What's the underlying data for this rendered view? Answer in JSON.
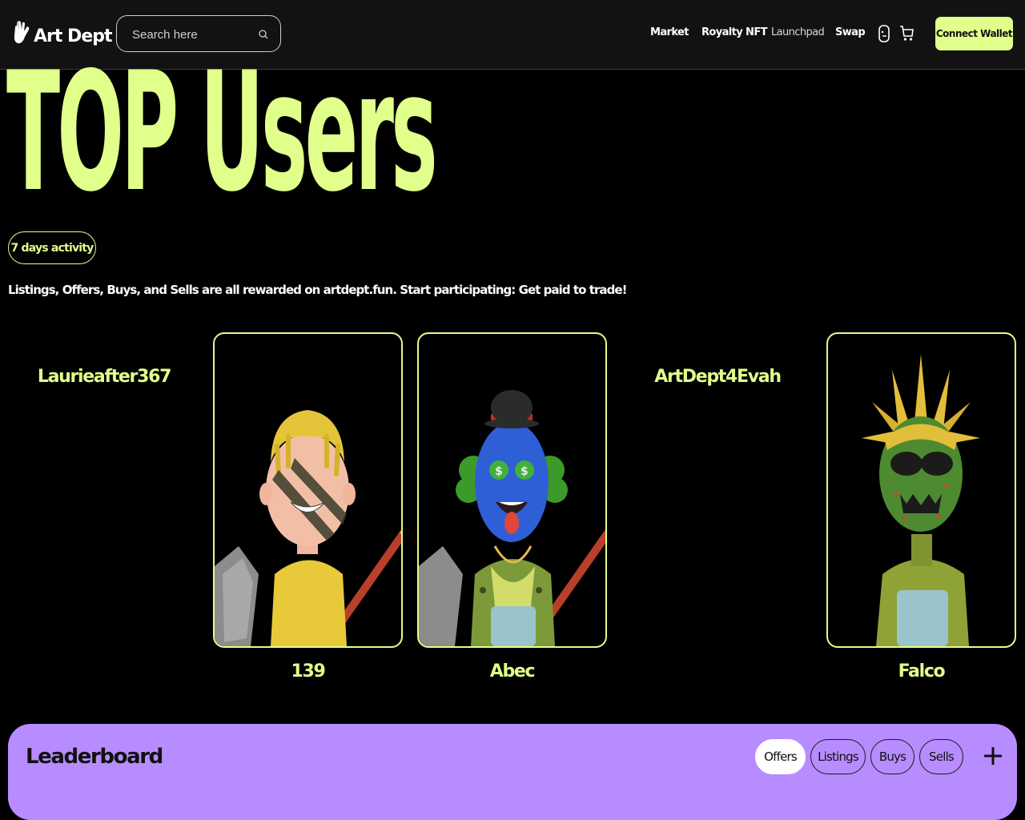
{
  "header": {
    "logo_text": "Art Dept",
    "search_placeholder": "Search here",
    "nav": [
      "Market",
      "Royalty NFT",
      "Launchpad",
      "Swap"
    ],
    "connect_label": "Connect Wallet"
  },
  "hero": {
    "title": "TOP Users",
    "activity_label": "7 days activity",
    "tagline": "Listings, Offers, Buys, and Sells are all rewarded on artdept.fun. Start participating: Get paid to trade!"
  },
  "users": [
    {
      "name": "Laurieafter367",
      "has_image": false
    },
    {
      "name": "139",
      "has_image": true
    },
    {
      "name": "Abec",
      "has_image": true
    },
    {
      "name": "ArtDept4Evah",
      "has_image": false
    },
    {
      "name": "Falco",
      "has_image": true
    }
  ],
  "leaderboard": {
    "title": "Leaderboard",
    "tabs": [
      "Offers",
      "Listings",
      "Buys",
      "Sells"
    ],
    "active_tab": "Offers"
  },
  "colors": {
    "accent": "#e1ff8b",
    "leaderboard_bg": "#b78cff",
    "header_bg": "#121212"
  }
}
